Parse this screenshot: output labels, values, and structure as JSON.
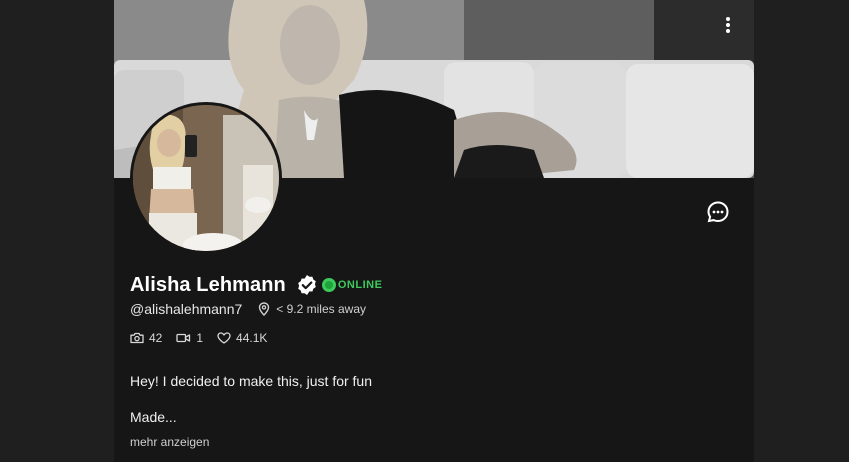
{
  "profile": {
    "name": "Alisha Lehmann",
    "status": "ONLINE",
    "handle": "@alishalehmann7",
    "distance": "< 9.2 miles away"
  },
  "stats": {
    "photos": "42",
    "videos": "1",
    "likes": "44.1K"
  },
  "bio": {
    "line1": "Hey! I decided to make this, just for fun",
    "line2": "Made...",
    "show_more": "mehr anzeigen"
  },
  "icons": {
    "menu": "vertical-dots-icon",
    "chat": "chat-bubble-icon",
    "verified": "verified-check-icon",
    "location": "map-pin-icon",
    "photos": "camera-icon",
    "videos": "video-camera-icon",
    "likes": "heart-icon"
  },
  "colors": {
    "background": "#1f1f1f",
    "panel": "#161616",
    "online": "#3ec95c"
  }
}
